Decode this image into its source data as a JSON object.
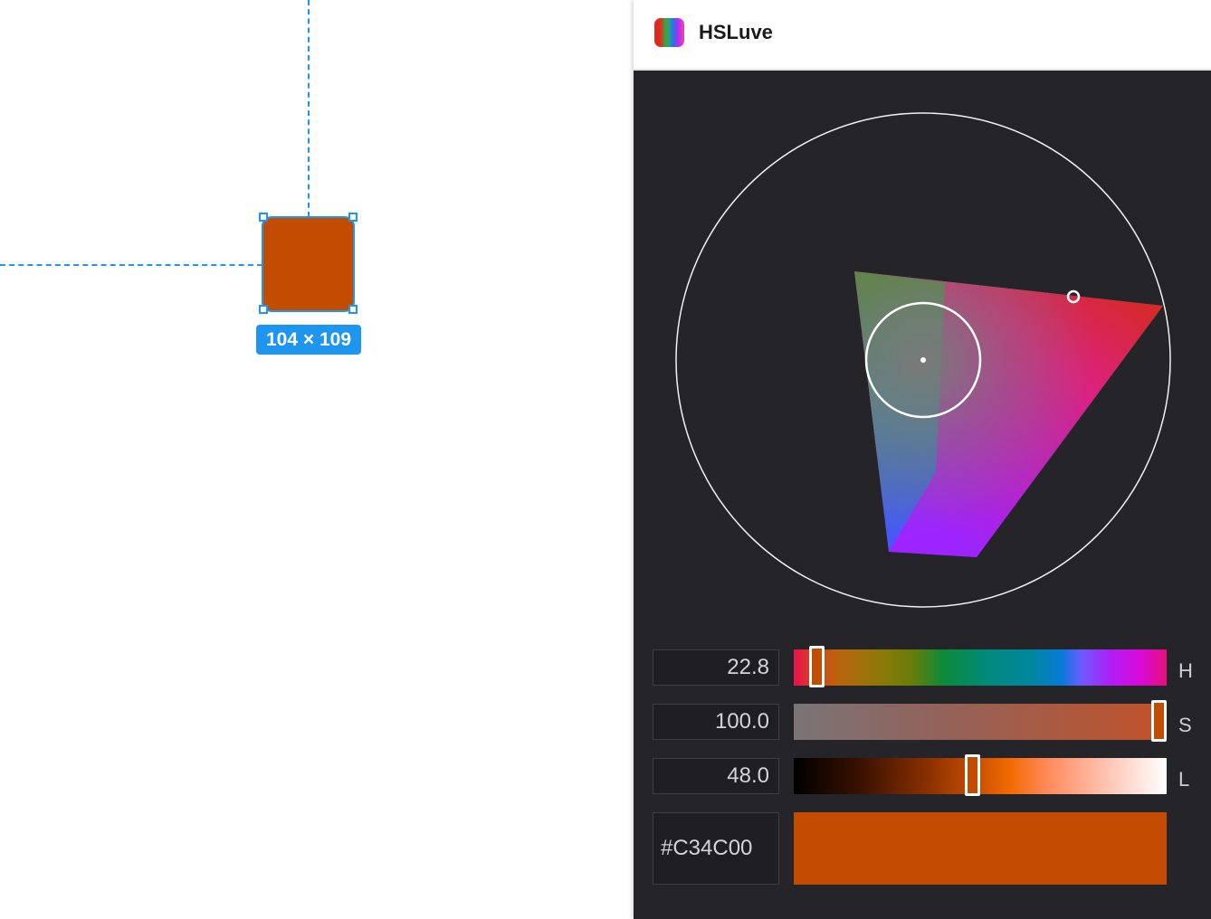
{
  "canvas": {
    "selection_size": "104 × 109",
    "guide_color": "#1e96f0"
  },
  "plugin": {
    "title": "HSLuve",
    "icon": "hsluv-gradient-icon"
  },
  "controls": {
    "hue": {
      "value": "22.8",
      "label": "H",
      "fraction": 0.063
    },
    "saturation": {
      "value": "100.0",
      "label": "S",
      "fraction": 1.0
    },
    "lightness": {
      "value": "48.0",
      "label": "L",
      "fraction": 0.48
    },
    "hex": "#C34C00"
  },
  "colors": {
    "selected": "#c34c00",
    "panel_bg": "#252428",
    "accent": "#1e96f0"
  }
}
